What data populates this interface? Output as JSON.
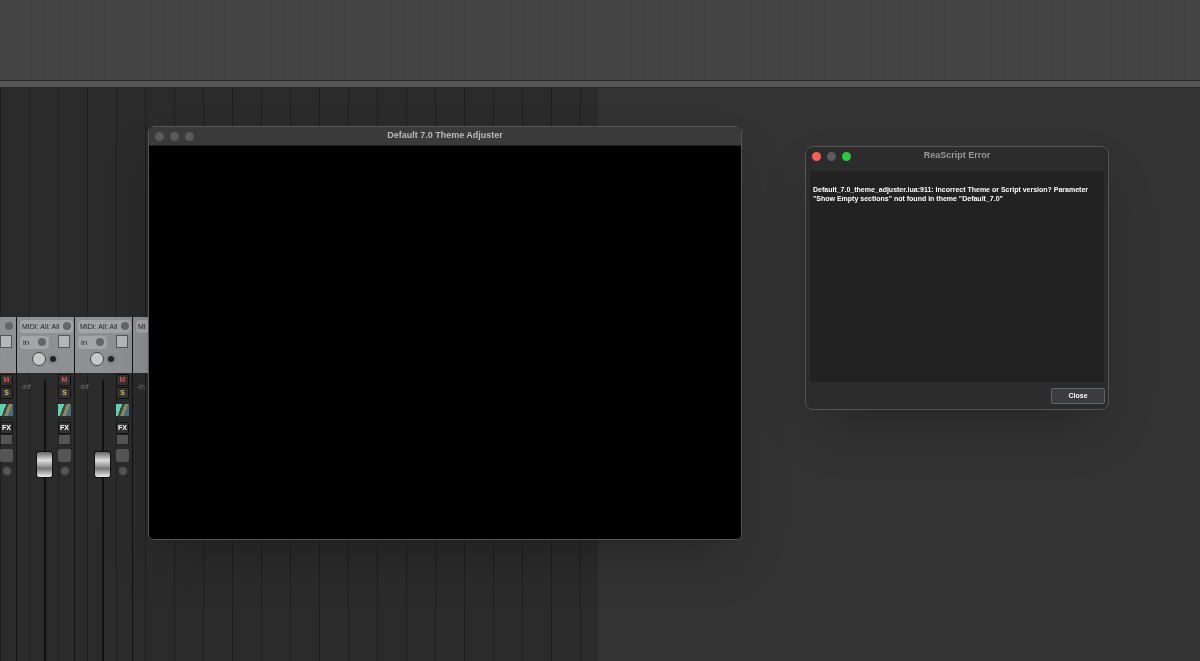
{
  "mixer": {
    "strips": [
      {
        "kind": "partial",
        "mute": "M",
        "solo": "S",
        "fx": "FX"
      },
      {
        "kind": "full",
        "midi": "MIDI: All: All",
        "input": "in",
        "volume": "-inf",
        "mute": "M",
        "solo": "S",
        "fx": "FX",
        "fader": {
          "level": 0.72
        }
      },
      {
        "kind": "full",
        "midi": "MIDI: All: All",
        "input": "in",
        "volume": "-inf",
        "mute": "M",
        "solo": "S",
        "fx": "FX",
        "fader": {
          "level": 0.72
        }
      },
      {
        "kind": "cut",
        "midi": "MI",
        "volume": "-in"
      }
    ]
  },
  "theme_window": {
    "title": "Default 7.0 Theme Adjuster"
  },
  "error_dialog": {
    "title": "ReaScript Error",
    "message": "Default_7.0_theme_adjuster.lua:911: Incorrect Theme or Script version? Parameter \"Show Empty sections\" not found in theme \"Default_7.0\"",
    "buttons": [
      "Close"
    ]
  }
}
